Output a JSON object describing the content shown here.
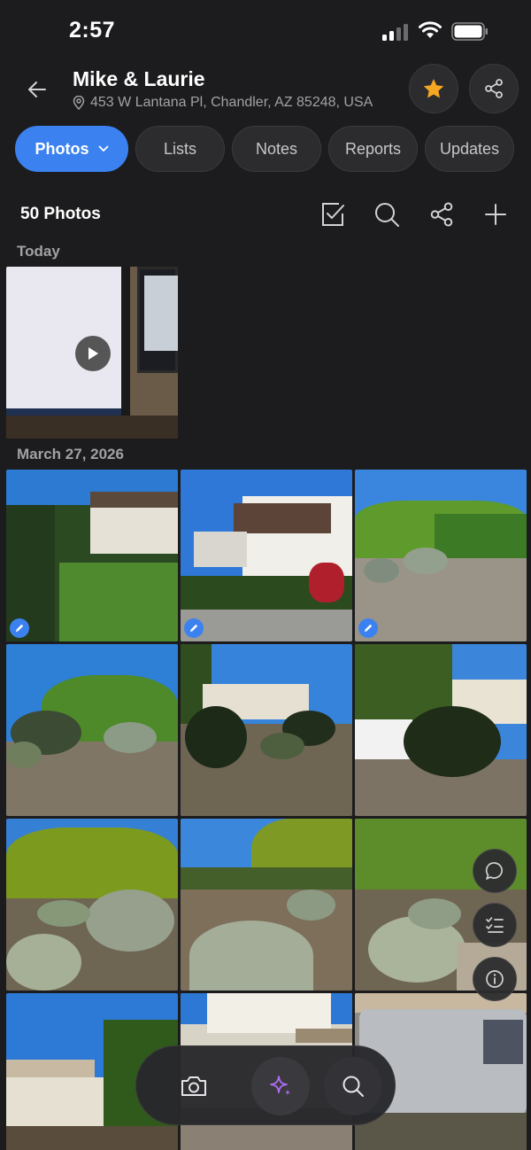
{
  "status": {
    "time": "2:57"
  },
  "header": {
    "title": "Mike & Laurie",
    "address": "453 W Lantana Pl, Chandler, AZ 85248, USA"
  },
  "tabs": [
    {
      "label": "Photos",
      "active": true
    },
    {
      "label": "Lists"
    },
    {
      "label": "Notes"
    },
    {
      "label": "Reports"
    },
    {
      "label": "Updates"
    }
  ],
  "photos": {
    "count_label": "50 Photos"
  },
  "sections": [
    {
      "label": "Today"
    },
    {
      "label": "March 27, 2026"
    }
  ],
  "colors": {
    "accent": "#3b82f0",
    "star": "#f5a623",
    "dock_ai": "#b26cf5"
  },
  "icons": [
    "back-arrow-icon",
    "location-pin-icon",
    "star-icon",
    "share-icon",
    "chevron-down-icon",
    "select-checkbox-icon",
    "search-icon",
    "plus-icon",
    "play-icon",
    "pencil-icon",
    "chat-bubble-icon",
    "checklist-icon",
    "info-icon",
    "camera-icon",
    "sparkle-icon"
  ]
}
